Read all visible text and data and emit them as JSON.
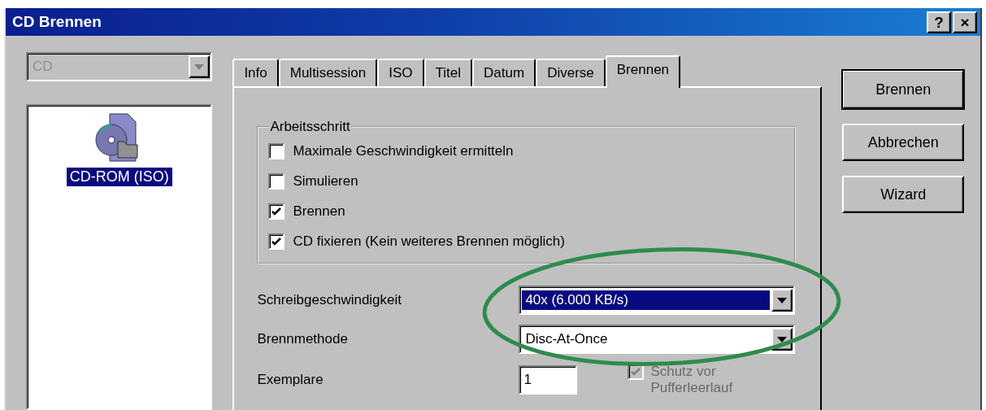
{
  "window": {
    "title": "CD Brennen",
    "title_buttons": [
      "?",
      "×"
    ]
  },
  "drive_select": {
    "value": "CD",
    "disabled": true
  },
  "project_list": [
    {
      "label": "CD-ROM (ISO)",
      "selected": true
    }
  ],
  "tabs": [
    {
      "label": "Info",
      "selected": false
    },
    {
      "label": "Multisession",
      "selected": false
    },
    {
      "label": "ISO",
      "selected": false
    },
    {
      "label": "Titel",
      "selected": false
    },
    {
      "label": "Datum",
      "selected": false
    },
    {
      "label": "Diverse",
      "selected": false
    },
    {
      "label": "Brennen",
      "selected": true
    }
  ],
  "group": {
    "title": "Arbeitsschritt",
    "options": [
      {
        "label": "Maximale Geschwindigkeit ermitteln",
        "checked": false
      },
      {
        "label": "Simulieren",
        "checked": false
      },
      {
        "label": "Brennen",
        "checked": true
      },
      {
        "label": "CD fixieren (Kein weiteres Brennen möglich)",
        "checked": true
      }
    ]
  },
  "fields": [
    {
      "kind": "select",
      "label": "Schreibgeschwindigkeit",
      "value": "40x (6.000 KB/s)",
      "focused": true
    },
    {
      "kind": "select",
      "label": "Brennmethode",
      "value": "Disc-At-Once",
      "focused": false
    },
    {
      "kind": "input",
      "label": "Exemplare",
      "value": "1",
      "option": {
        "label": "Schutz vor Pufferleerlauf",
        "checked": true,
        "disabled": true
      }
    }
  ],
  "buttons": [
    {
      "label": "Brennen",
      "default": true
    },
    {
      "label": "Abbrechen",
      "default": false
    },
    {
      "label": "Wizard",
      "default": false
    }
  ]
}
